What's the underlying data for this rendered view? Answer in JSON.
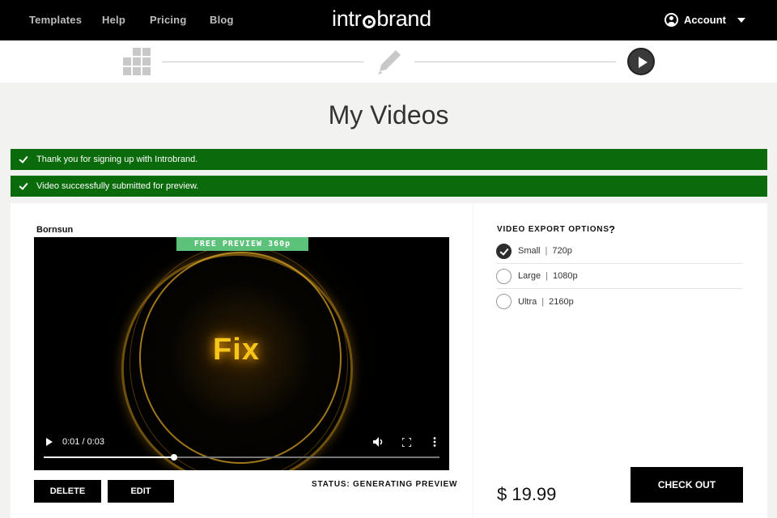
{
  "nav": {
    "links": [
      "Templates",
      "Help",
      "Pricing",
      "Blog"
    ],
    "logo": {
      "prefix": "intr",
      "suffix": "brand"
    },
    "account_label": "Account"
  },
  "steps": {
    "icons": [
      "grid-icon",
      "pencil-icon",
      "play-icon"
    ],
    "active_step": 3
  },
  "page": {
    "title": "My Videos"
  },
  "alerts": [
    "Thank you for signing up with Introbrand.",
    "Video successfully submitted for preview."
  ],
  "video": {
    "name": "Bornsun",
    "badge": "FREE PREVIEW 360p",
    "overlay_text": "Fix",
    "time": "0:01 / 0:03",
    "progress": 0.33
  },
  "actions": {
    "delete_label": "DELETE",
    "edit_label": "EDIT",
    "status": "STATUS: GENERATING PREVIEW"
  },
  "export": {
    "title": "VIDEO EXPORT OPTIONS",
    "help": "?",
    "options": [
      {
        "size": "Small",
        "resolution": "720p",
        "selected": true
      },
      {
        "size": "Large",
        "resolution": "1080p",
        "selected": false
      },
      {
        "size": "Ultra",
        "resolution": "2160p",
        "selected": false
      }
    ]
  },
  "checkout": {
    "price": "$ 19.99",
    "button_label": "CHECK OUT"
  },
  "colors": {
    "nav_bg": "#000000",
    "alert_bg": "#0a6b0a",
    "badge_bg": "#5cc27a",
    "fix_text": "#f5c518"
  }
}
